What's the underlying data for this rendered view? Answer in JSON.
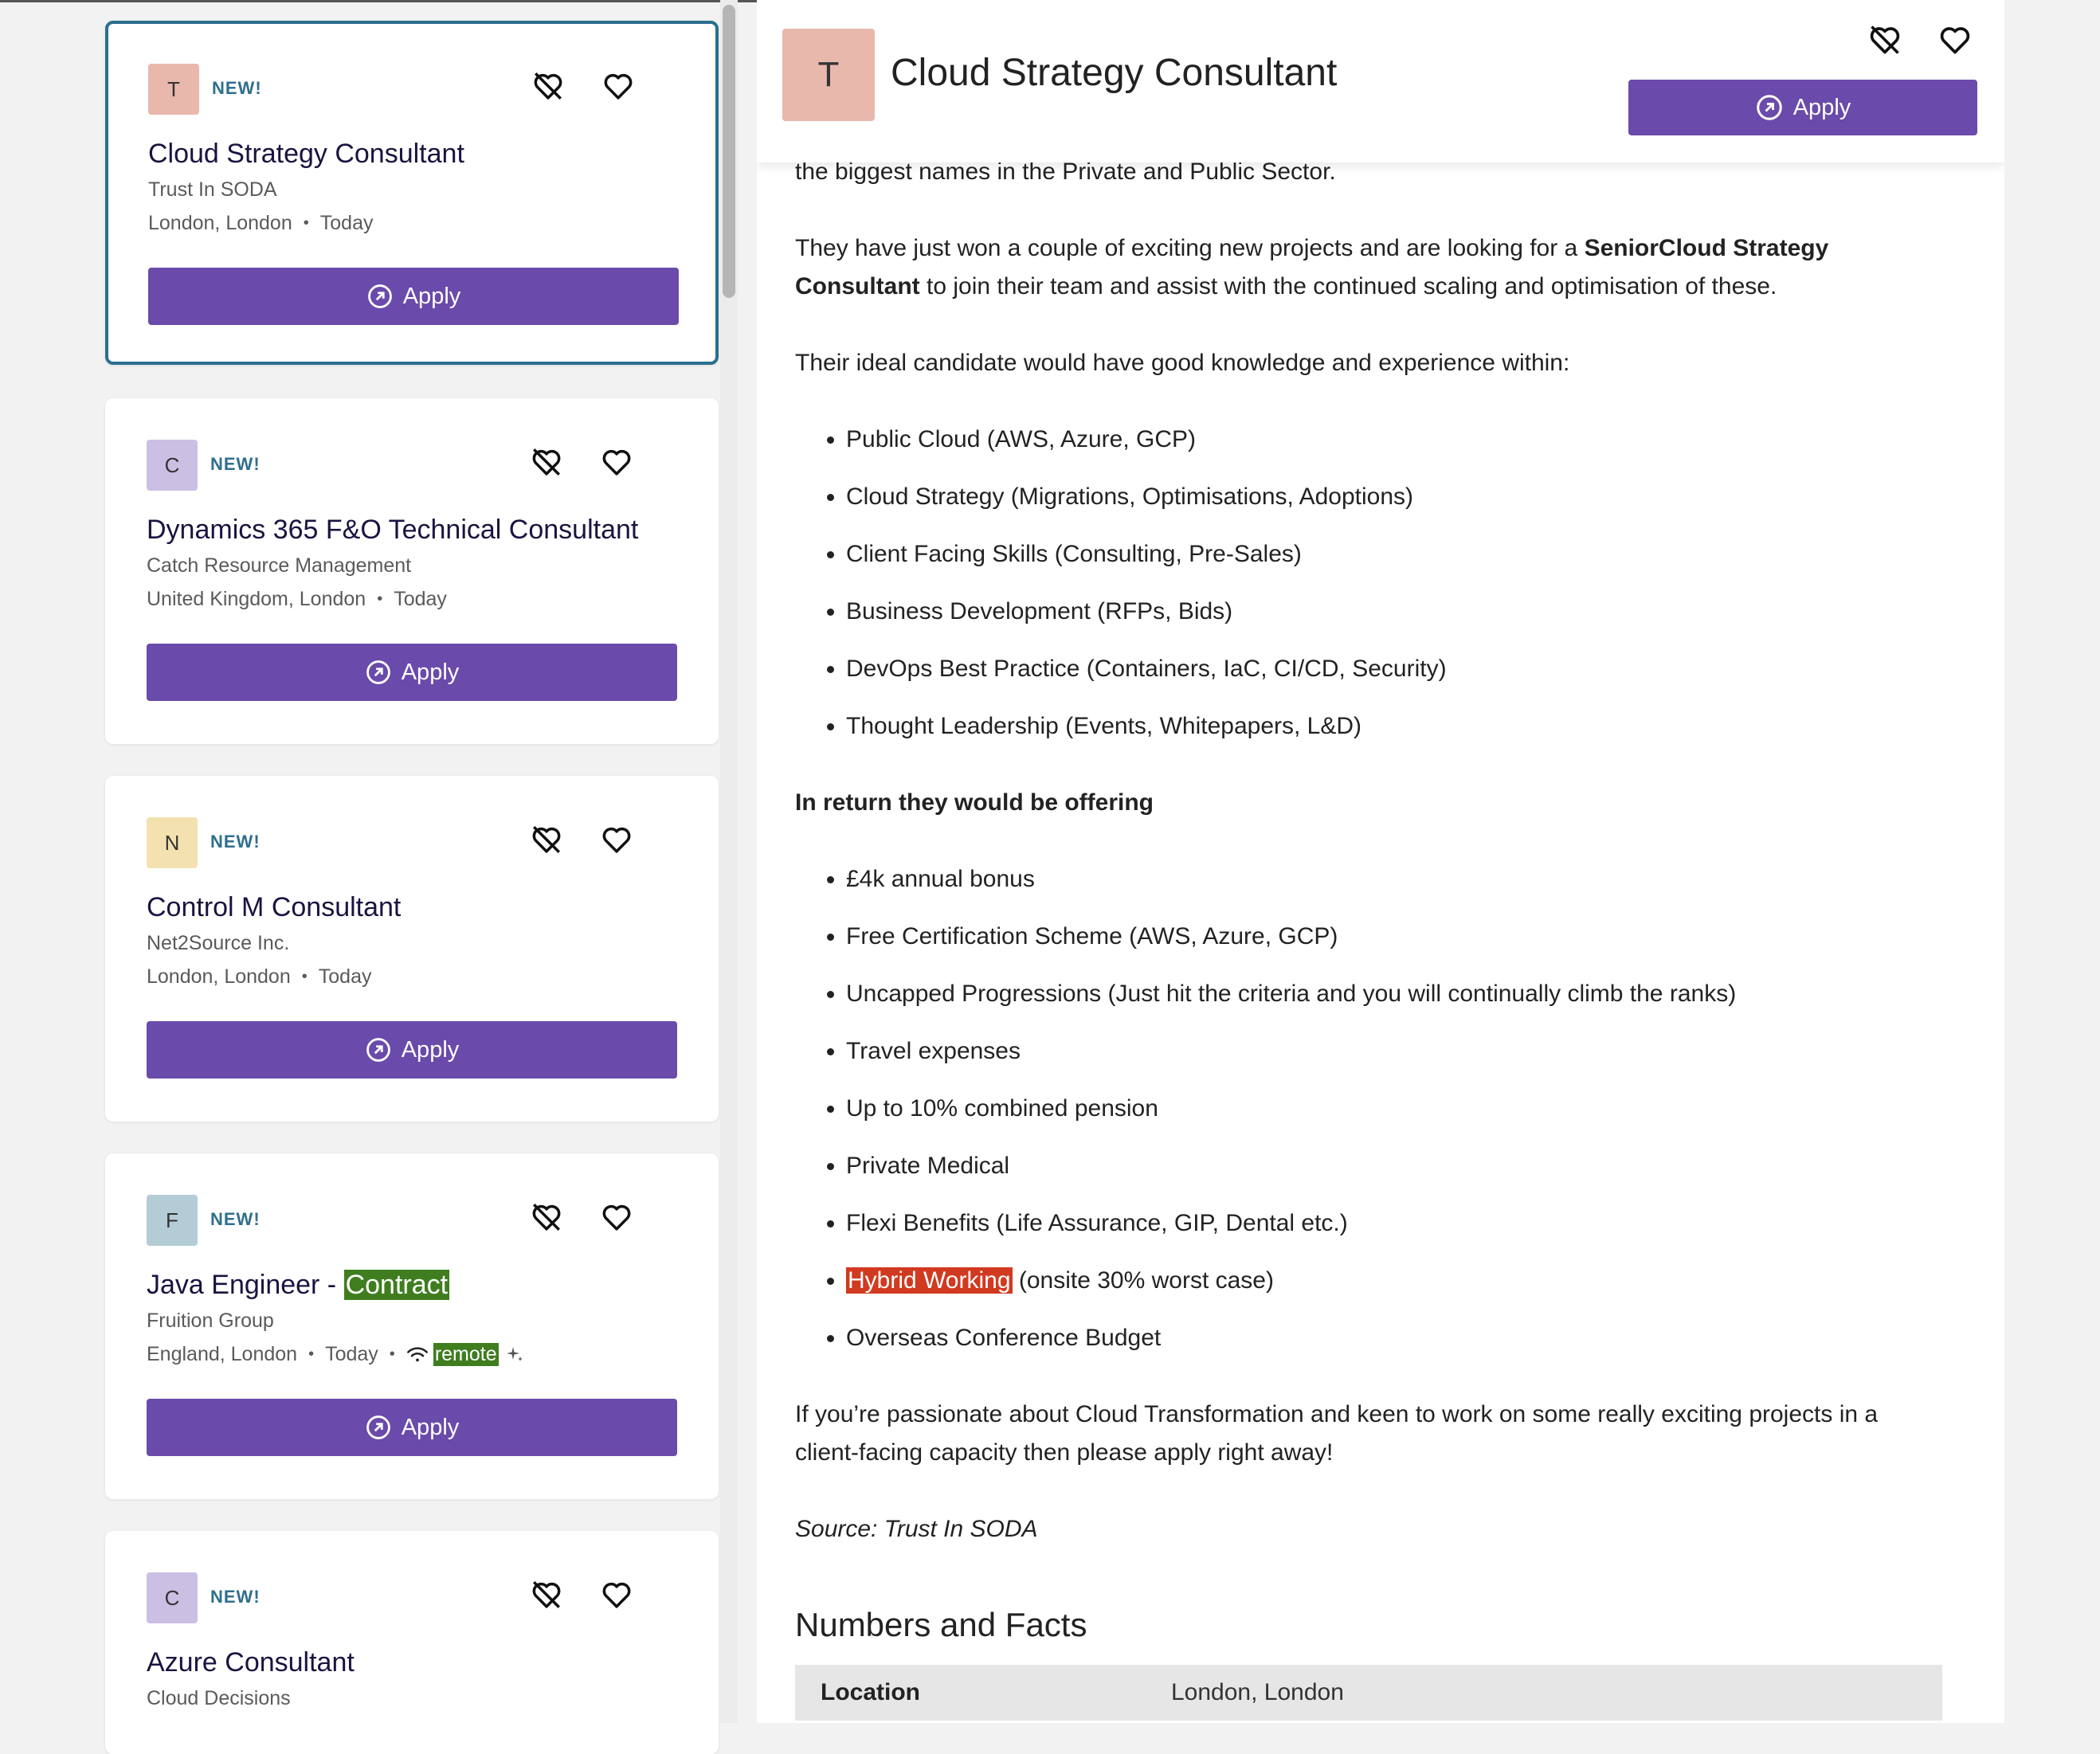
{
  "jobs": [
    {
      "initial": "T",
      "avatar_color": "#e8b8ad",
      "badge": "NEW!",
      "title": "Cloud Strategy Consultant",
      "title_highlight": "",
      "company": "Trust In SODA",
      "location": "London, London",
      "posted": "Today",
      "remote": "",
      "apply": "Apply",
      "selected": true
    },
    {
      "initial": "C",
      "avatar_color": "#cbbfe3",
      "badge": "NEW!",
      "title": "Dynamics 365 F&O Technical Consultant",
      "title_highlight": "",
      "company": "Catch Resource Management",
      "location": "United Kingdom, London",
      "posted": "Today",
      "remote": "",
      "apply": "Apply",
      "selected": false
    },
    {
      "initial": "N",
      "avatar_color": "#f3e2b0",
      "badge": "NEW!",
      "title": "Control M Consultant",
      "title_highlight": "",
      "company": "Net2Source Inc.",
      "location": "London, London",
      "posted": "Today",
      "remote": "",
      "apply": "Apply",
      "selected": false
    },
    {
      "initial": "F",
      "avatar_color": "#b3ccd6",
      "badge": "NEW!",
      "title": "Java Engineer - ",
      "title_highlight": "Contract",
      "company": "Fruition Group",
      "location": "England, London",
      "posted": "Today",
      "remote": "remote",
      "apply": "Apply",
      "selected": false
    },
    {
      "initial": "C",
      "avatar_color": "#cbbfe3",
      "badge": "NEW!",
      "title": "Azure Consultant",
      "title_highlight": "",
      "company": "Cloud Decisions",
      "location": "",
      "posted": "",
      "remote": "",
      "apply": "",
      "selected": false
    }
  ],
  "detail": {
    "initial": "T",
    "title": "Cloud Strategy Consultant",
    "apply": "Apply",
    "intro_tail": "the biggest names in the Private and Public Sector.",
    "para1_start": "They have just won a couple of exciting new projects and are looking for a ",
    "para1_bold": "SeniorCloud Strategy Consultant",
    "para1_end": " to join their team and assist with the continued scaling and optimisation of these.",
    "para2": "Their ideal candidate would have good knowledge and experience within:",
    "skills": [
      "Public Cloud (AWS, Azure, GCP)",
      "Cloud Strategy (Migrations, Optimisations, Adoptions)",
      "Client Facing Skills (Consulting, Pre-Sales)",
      "Business Development (RFPs, Bids)",
      "DevOps Best Practice (Containers, IaC, CI/CD, Security)",
      "Thought Leadership (Events, Whitepapers, L&D)"
    ],
    "offer_heading": "In return they would be offering",
    "benefits": [
      "£4k annual bonus",
      "Free Certification Scheme (AWS, Azure, GCP)",
      "Uncapped Progressions (Just hit the criteria and you will continually climb the ranks)",
      "Travel expenses",
      "Up to 10% combined pension",
      "Private Medical",
      "Flexi Benefits (Life Assurance, GIP, Dental etc.)"
    ],
    "hybrid_highlight": "Hybrid Working",
    "hybrid_rest": " (onsite 30% worst case)",
    "last_benefit": "Overseas Conference Budget",
    "closing": "If you’re passionate about Cloud Transformation and keen to work on some really exciting projects in a client-facing capacity then please apply right away!",
    "source": "Source: Trust In SODA",
    "facts_title": "Numbers and Facts",
    "facts": [
      {
        "key": "Location",
        "value": "London, London"
      }
    ]
  },
  "colors": {
    "accent": "#6a4aaa",
    "selected_border": "#2b6f8f",
    "badge": "#2f6f8d",
    "highlight_green": "#3f7d1f",
    "highlight_red": "#d13a20"
  }
}
